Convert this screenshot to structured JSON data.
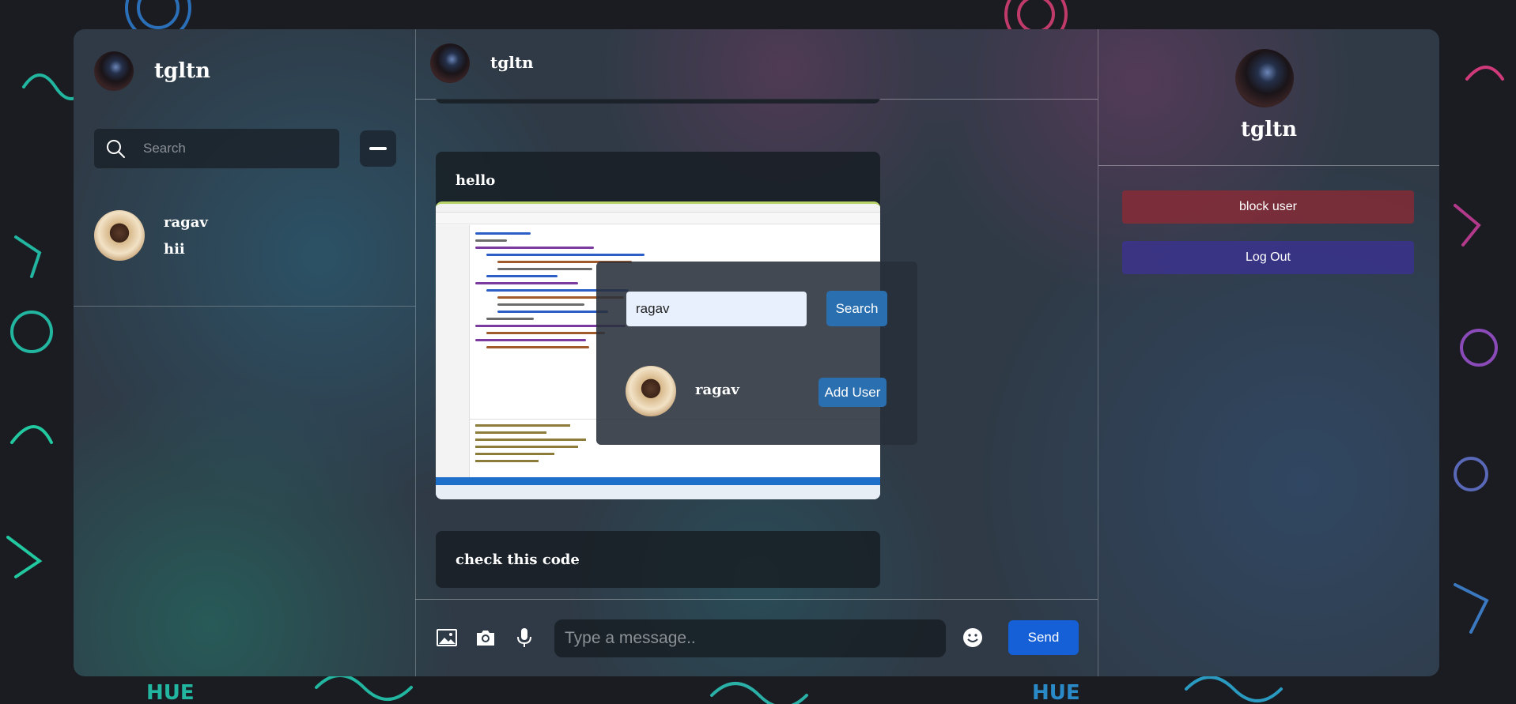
{
  "sidebar": {
    "username": "tgltn",
    "search_placeholder": "Search",
    "chats": [
      {
        "name": "ragav",
        "last_message": "hii"
      }
    ]
  },
  "chat": {
    "header_name": "tgltn",
    "messages": [
      {
        "type": "text",
        "text": "hello"
      },
      {
        "type": "image",
        "description": "code editor screenshot"
      },
      {
        "type": "text",
        "text": "check this code"
      }
    ],
    "input_placeholder": "Type a message..",
    "send_label": "Send"
  },
  "profile": {
    "username": "tgltn",
    "block_label": "block user",
    "logout_label": "Log Out"
  },
  "add_user_popup": {
    "search_value": "ragav",
    "search_button": "Search",
    "result_name": "ragav",
    "add_button": "Add User"
  },
  "colors": {
    "send": "#1560d6",
    "block": "#963a44",
    "logout": "#3c3296",
    "popup_button": "#2a6fb0"
  }
}
